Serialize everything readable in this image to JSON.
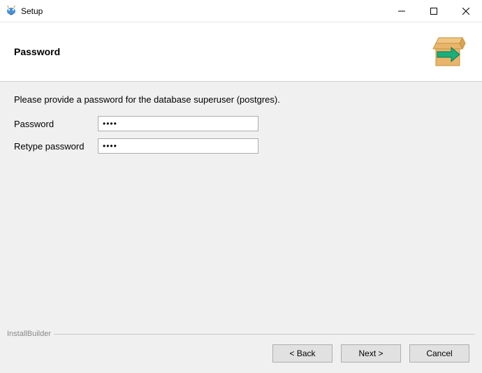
{
  "window": {
    "title": "Setup",
    "minimize_label": "Minimize",
    "maximize_label": "Maximize",
    "close_label": "Close"
  },
  "header": {
    "heading": "Password"
  },
  "body": {
    "instruction": "Please provide a password for the database superuser (postgres).",
    "password_label": "Password",
    "password_value": "****",
    "retype_label": "Retype password",
    "retype_value": "****"
  },
  "footer": {
    "brand": "InstallBuilder",
    "back_label": "< Back",
    "next_label": "Next >",
    "cancel_label": "Cancel"
  },
  "icons": {
    "app": "elephant-icon",
    "header": "box-arrow-icon"
  }
}
